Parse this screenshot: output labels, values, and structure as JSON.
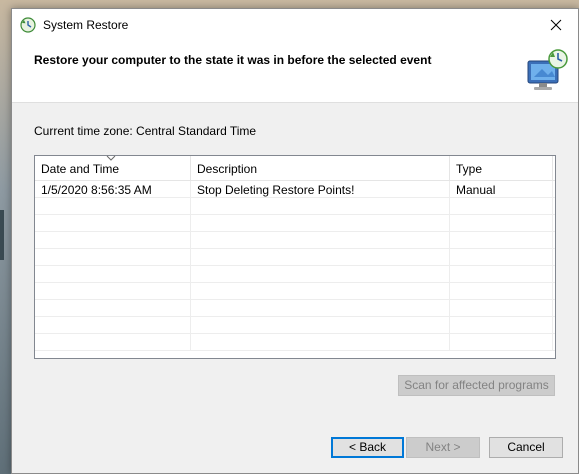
{
  "window": {
    "title": "System Restore",
    "close_glyph": "✕"
  },
  "header": {
    "title": "Restore your computer to the state it was in before the selected event",
    "icon": "system-restore-monitor-icon"
  },
  "timezone_label": "Current time zone: Central Standard Time",
  "table": {
    "columns": [
      "Date and Time",
      "Description",
      "Type"
    ],
    "sort_column": "Date and Time",
    "rows": [
      {
        "date": "1/5/2020 8:56:35 AM",
        "description": "Stop Deleting Restore Points!",
        "type": "Manual"
      }
    ]
  },
  "buttons": {
    "scan": "Scan for affected programs",
    "back": "< Back",
    "next": "Next >",
    "cancel": "Cancel"
  },
  "colors": {
    "accent": "#0078d7",
    "window_bg": "#f0f0f0"
  }
}
